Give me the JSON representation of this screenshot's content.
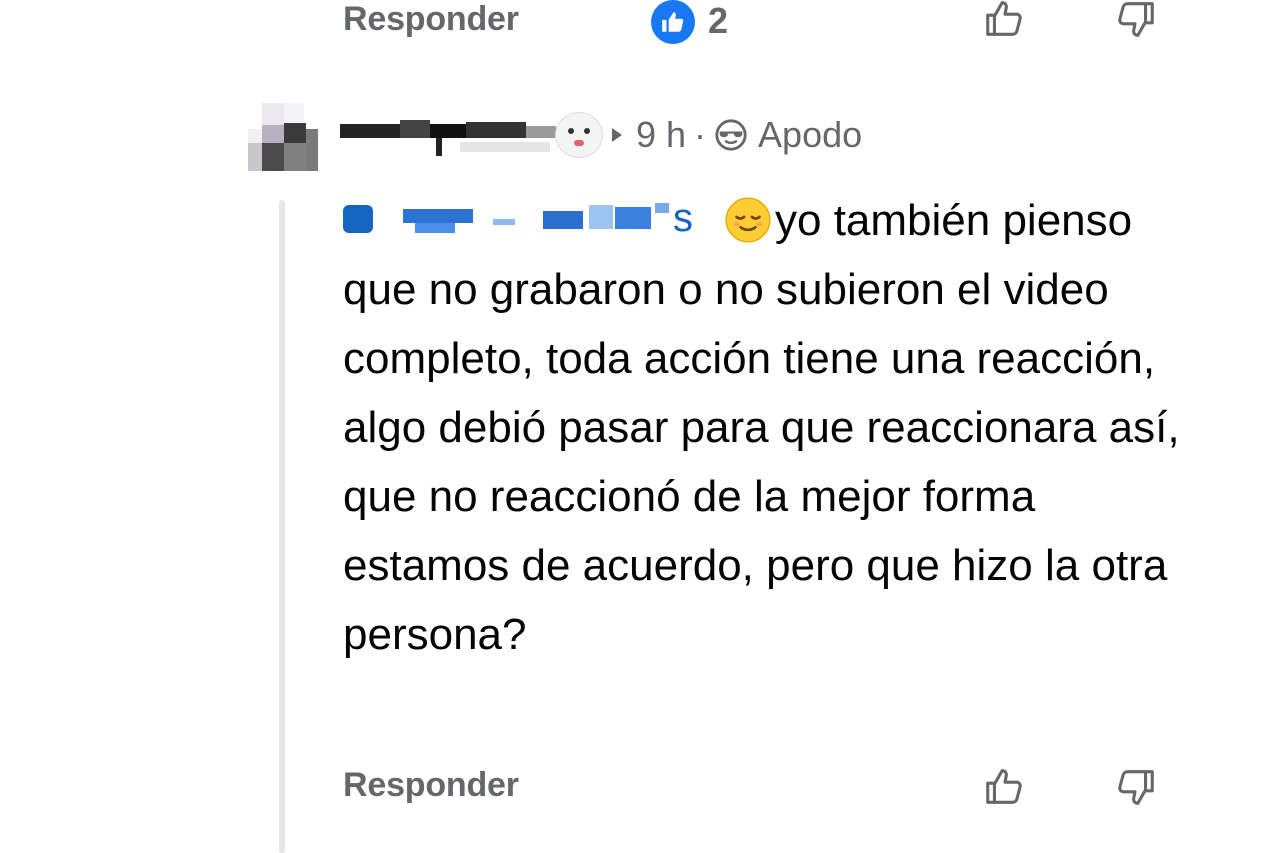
{
  "previous_comment": {
    "reply_label": "Responder",
    "like_count": "2",
    "reaction_icon": "thumbs-up-reaction-icon"
  },
  "comment": {
    "time": "9 h",
    "separator": "·",
    "badge_label": "Apodo",
    "badge_icon": "sunglasses-emoji-icon",
    "text": "yo también pienso que no grabaron o no subieron el video completo, toda acción tiene una reacción, algo debió pasar para que reaccionara así, que no reaccionó de la mejor forma estamos de acuerdo, pero que hizo la otra persona?",
    "emoji": "relieved-face-emoji",
    "reply_label": "Responder"
  },
  "colors": {
    "facebook_blue": "#1877f2",
    "secondary_text": "#65676b",
    "thread_line": "#e4e6eb"
  }
}
